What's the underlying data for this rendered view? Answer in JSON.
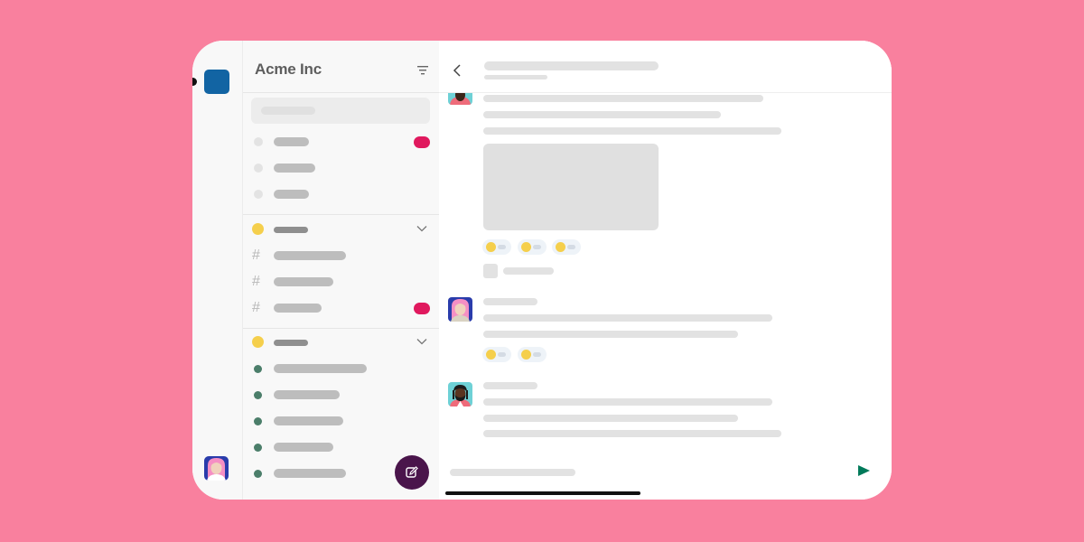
{
  "workspace": {
    "name": "Acme Inc",
    "icon_color": "#1264a3"
  },
  "icons": {
    "filter": "filter-icon",
    "back": "chevron-left-icon",
    "compose": "compose-icon",
    "send": "send-icon",
    "collapse": "chevron-down-icon",
    "channel": "hash-icon"
  },
  "colors": {
    "background": "#f9809e",
    "badge": "#e0195e",
    "section_dot": "#f5cf4c",
    "online_dot": "#4b7e6a",
    "compose_button": "#4a154b",
    "send_button": "#007a5a"
  },
  "sidebar": {
    "search_placeholder": "",
    "top_items": [
      {
        "unread_badge": true
      },
      {
        "unread_badge": false
      },
      {
        "unread_badge": false
      }
    ],
    "sections": [
      {
        "name": "",
        "collapsed": false,
        "items": [
          {
            "type": "channel",
            "unread_badge": false
          },
          {
            "type": "channel",
            "unread_badge": false
          },
          {
            "type": "channel",
            "unread_badge": true
          }
        ]
      },
      {
        "name": "",
        "collapsed": false,
        "items": [
          {
            "type": "dm",
            "presence": "online"
          },
          {
            "type": "dm",
            "presence": "online"
          },
          {
            "type": "dm",
            "presence": "online"
          },
          {
            "type": "dm",
            "presence": "online"
          },
          {
            "type": "dm",
            "presence": "online"
          }
        ]
      }
    ]
  },
  "conversation": {
    "title": "",
    "subtitle": "",
    "messages": [
      {
        "avatar": "avatar-person-dark",
        "has_image": true,
        "reactions": 3,
        "has_attachment_row": true
      },
      {
        "avatar": "avatar-person-pink-hair",
        "has_image": false,
        "reactions": 2
      },
      {
        "avatar": "avatar-person-beard",
        "has_image": false,
        "reactions": 0
      }
    ],
    "composer_placeholder": ""
  }
}
